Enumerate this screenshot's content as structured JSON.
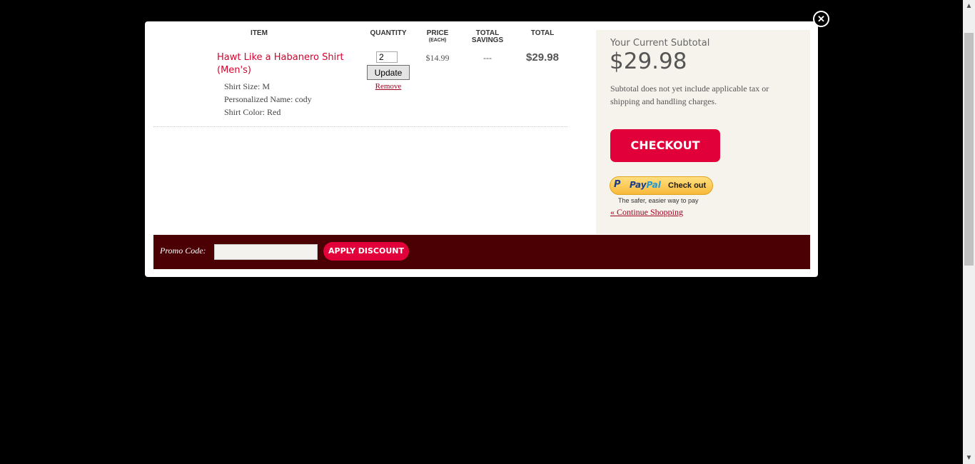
{
  "cart": {
    "headers": {
      "item": "ITEM",
      "quantity": "QUANTITY",
      "price": "PRICE",
      "price_sub": "(EACH)",
      "savings_line1": "TOTAL",
      "savings_line2": "SAVINGS",
      "total": "TOTAL"
    },
    "item": {
      "name": "Hawt Like a Habanero Shirt (Men's)",
      "attributes": [
        "Shirt Size: M",
        "Personalized Name: cody",
        "Shirt Color: Red"
      ],
      "quantity": "2",
      "update_label": "Update",
      "remove_label": "Remove",
      "price": "$14.99",
      "savings": "---",
      "total": "$29.98"
    }
  },
  "summary": {
    "label": "Your Current Subtotal",
    "amount": "$29.98",
    "note": "Subtotal does not yet include applicable tax or shipping and handling charges.",
    "checkout_label": "CHECKOUT",
    "paypal": {
      "pay": "Pay",
      "pal": "Pal",
      "cta": "Check out",
      "tagline": "The safer, easier way to pay"
    },
    "continue_label": "« Continue Shopping"
  },
  "promo": {
    "label": "Promo Code:",
    "value": "",
    "button_label": "APPLY DISCOUNT"
  },
  "icons": {
    "close": "close-icon",
    "paypal": "paypal-icon",
    "scroll_up": "scroll-up-icon",
    "scroll_down": "scroll-down-icon"
  },
  "colors": {
    "accent": "#e2003a",
    "promo_bar": "#4b0004",
    "sidebar_bg": "#f6f3ec"
  }
}
